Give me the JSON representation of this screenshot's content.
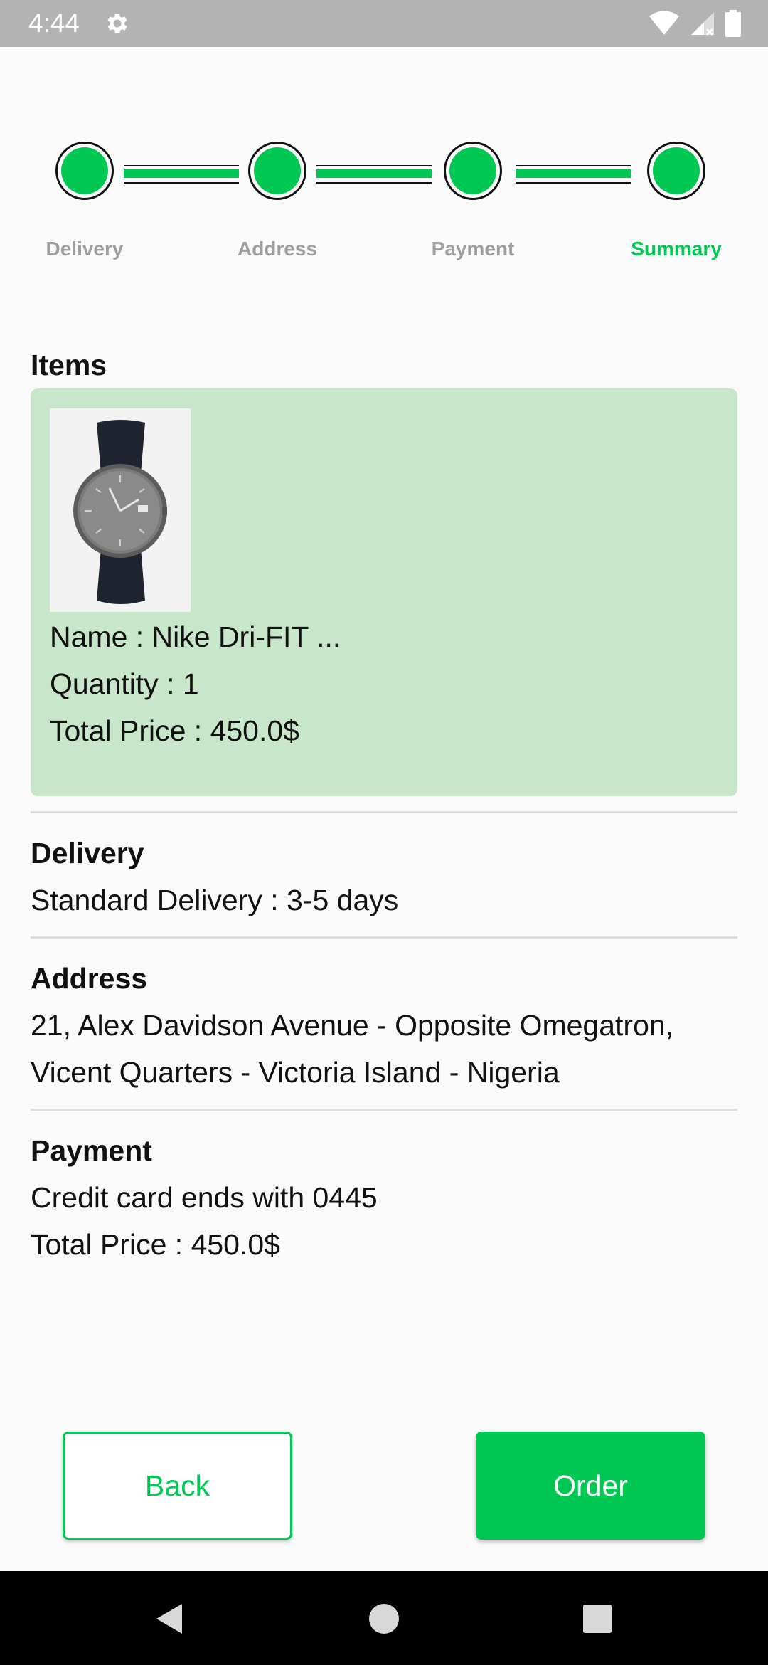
{
  "status_bar": {
    "time": "4:44",
    "icons": [
      "settings-gear-icon",
      "wifi-icon",
      "cell-signal-icon",
      "battery-icon"
    ]
  },
  "stepper": {
    "steps": [
      {
        "label": "Delivery",
        "completed": true,
        "active": false
      },
      {
        "label": "Address",
        "completed": true,
        "active": false
      },
      {
        "label": "Payment",
        "completed": true,
        "active": false
      },
      {
        "label": "Summary",
        "completed": true,
        "active": true
      }
    ],
    "colors": {
      "complete": "#00c853",
      "inactive_label": "#9e9e9e",
      "active_label": "#00c853"
    }
  },
  "items": {
    "heading": "Items",
    "card_color": "#c8e6c9",
    "product": {
      "image": "wristwatch-product-image",
      "name_line": "Name : Nike Dri-FIT ...",
      "quantity_line": "Quantity : 1",
      "total_line": "Total Price : 450.0$"
    }
  },
  "delivery": {
    "heading": "Delivery",
    "text": "Standard Delivery : 3-5 days"
  },
  "address": {
    "heading": "Address",
    "line1": "21, Alex Davidson Avenue - Opposite Omegatron,",
    "line2": "Vicent Quarters - Victoria Island - Nigeria"
  },
  "payment": {
    "heading": "Payment",
    "card_line": "Credit card ends with 0445",
    "total_line": "Total Price : 450.0$"
  },
  "buttons": {
    "back_label": "Back",
    "order_label": "Order",
    "accent": "#00c853"
  },
  "nav_bar": {
    "icons": [
      "back-triangle-icon",
      "home-circle-icon",
      "recents-square-icon"
    ]
  }
}
